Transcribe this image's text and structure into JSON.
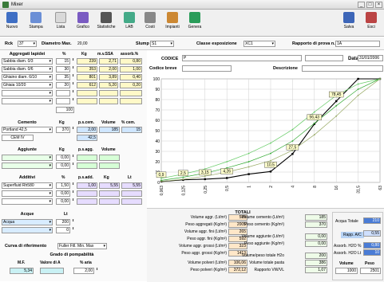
{
  "window": {
    "title": "Mixer"
  },
  "toolbar": {
    "nuovo": "Nuovo",
    "stampa": "Stampa",
    "lista": "Lista",
    "grafico": "Grafico",
    "statistiche": "Statistiche",
    "lab": "LAB",
    "costi": "Costi",
    "impianti": "Impianti",
    "genera": "Genera",
    "salva": "Salva",
    "esci": "Esci"
  },
  "header": {
    "rck_label": "Rck",
    "rck_value": "37",
    "diametro_label": "Diametro Max.",
    "diametro_value": "20,00",
    "slump_label": "Slump",
    "slump_value": "S1",
    "classe_label": "Classe esposizione",
    "classe_value": "XC1",
    "rapporto_label": "Rapporto di prova n.",
    "rapporto_value": "1A"
  },
  "aggregati": {
    "title": "Aggregati lapidei",
    "col_pct": "%",
    "col_kg": "Kg",
    "col_mv": "m.v.SSA",
    "col_ass": "assorb.%",
    "rows": [
      {
        "name": "Sabbia diam. 0/3",
        "pct": "15",
        "kg": "239",
        "mv": "2,71",
        "ass": "0,80"
      },
      {
        "name": "Sabbia diam. 0/6",
        "pct": "30",
        "kg": "353",
        "mv": "2,00",
        "ass": "1,00"
      },
      {
        "name": "Ghiaino diam. 6/10",
        "pct": "35",
        "kg": "801",
        "mv": "3,89",
        "ass": "0,40"
      },
      {
        "name": "Ghiaia 10/20",
        "pct": "20",
        "kg": "612",
        "mv": "5,20",
        "ass": "0,20"
      },
      {
        "name": "",
        "pct": "",
        "kg": "",
        "mv": "",
        "ass": ""
      },
      {
        "name": "",
        "pct": "",
        "kg": "",
        "mv": "",
        "ass": ""
      }
    ],
    "total": "100"
  },
  "cemento": {
    "title": "Cemento",
    "col_kg": "Kg",
    "col_ps": "p.s.cem.",
    "col_vol": "Volume",
    "col_pct": "% cem.",
    "rows": [
      {
        "name": "Portland 42,5",
        "kg": "370",
        "ps": "2,00",
        "vol": "185",
        "pct": "15"
      },
      {
        "name": "CEM IV",
        "kg": "",
        "ps": "42,5",
        "vol": "",
        "pct": ""
      }
    ]
  },
  "aggiunte": {
    "title": "Aggiunte",
    "col_kg": "Kg",
    "col_ps": "p.s.agg.",
    "col_vol": "Volume",
    "rows": [
      {
        "kg": "0,00"
      },
      {
        "kg": "0,00"
      }
    ]
  },
  "additivi": {
    "title": "Additivi",
    "col_pct": "%",
    "col_ps": "p.s.add.",
    "col_kg": "Kg",
    "col_lt": "Lt",
    "rows": [
      {
        "name": "Superfluid Rh580",
        "pct": "1,50",
        "ps": "1,00",
        "kg": "5,55",
        "lt": "5,55"
      },
      {
        "name": "",
        "pct": "0,00",
        "ps": "",
        "kg": "",
        "lt": ""
      },
      {
        "name": "",
        "pct": "0,00",
        "ps": "",
        "kg": "",
        "lt": ""
      }
    ]
  },
  "acque": {
    "title": "Acque",
    "col_lt": "Lt",
    "rows": [
      {
        "name": "Acqua",
        "lt": "200"
      },
      {
        "name": "",
        "lt": "0"
      }
    ]
  },
  "curva": {
    "label": "Curva di riferimento",
    "value": "Fuller Fill. Min. Max"
  },
  "pompabilita": {
    "title": "Grado di pompabilità",
    "mf_label": "M.F.",
    "valore_label": "Valore di A",
    "aria_label": "% aria",
    "mf": "5,34",
    "valore": "",
    "aria": "2,00"
  },
  "codice": {
    "label": "CODICE",
    "value": "P",
    "breve_label": "Codice breve",
    "breve_value": "",
    "descrizione_label": "Descrizione",
    "data_label": "Data",
    "data_value": "31/01/2006"
  },
  "chart_data": {
    "type": "line",
    "x": [
      "0,063",
      "0,125",
      "0,25",
      "0,5",
      "1",
      "2",
      "4",
      "8",
      "16",
      "31,5",
      "63"
    ],
    "ylim": [
      0,
      100
    ],
    "yticks": [
      "0",
      "10",
      "20",
      "30",
      "40",
      "50",
      "60",
      "70",
      "80",
      "90",
      "100"
    ],
    "series": [
      {
        "color": "#000000",
        "values": [
          0.9,
          2.5,
          3.15,
          4.26,
          8,
          10.5,
          27.5,
          56.43,
          78.45,
          100,
          100
        ]
      },
      {
        "color": "#33aa33",
        "values": [
          2,
          5,
          9,
          14,
          20,
          28,
          40,
          57,
          74,
          90,
          100
        ]
      },
      {
        "color": "#66cc66",
        "values": [
          4,
          8,
          13,
          20,
          28,
          38,
          51,
          68,
          84,
          95,
          100
        ]
      },
      {
        "color": "#99aa66",
        "values": [
          1,
          3,
          6,
          10,
          15,
          21,
          31,
          46,
          64,
          84,
          100
        ]
      }
    ],
    "labels": [
      {
        "x": "0,063",
        "y": 0.9,
        "text": "0,9"
      },
      {
        "x": "0,125",
        "y": 2.5,
        "text": "2,5"
      },
      {
        "x": "0,25",
        "y": 3.15,
        "text": "3,15"
      },
      {
        "x": "0,5",
        "y": 4.26,
        "text": "4,26"
      },
      {
        "x": "2",
        "y": 10.5,
        "text": "10,5"
      },
      {
        "x": "4",
        "y": 27.5,
        "text": "27,5"
      },
      {
        "x": "8",
        "y": 56.43,
        "text": "56,43"
      },
      {
        "x": "16",
        "y": 78.45,
        "text": "78,45"
      },
      {
        "x": "31,5",
        "y": 100,
        "text": "100"
      }
    ],
    "grid": true
  },
  "totali": {
    "title": "TOTALI",
    "col1": [
      {
        "label": "Volume aggr. (Lt/m³)",
        "value": "589"
      },
      {
        "label": "Peso aggregati (Kg/m³)",
        "value": "2005"
      },
      {
        "label": "Volume aggr. fini (Lt/m³)",
        "value": "265"
      },
      {
        "label": "Peso aggr. fini (Kg/m³)",
        "value": "592"
      },
      {
        "label": "Volume aggr. grossi (Lt/m³)",
        "value": "323"
      },
      {
        "label": "Peso aggr. grossi (Kg/m³)",
        "value": "1413"
      },
      {
        "label": "Volume polveri (Lt/m³)",
        "value": "106,06"
      },
      {
        "label": "Peso polveri (Kg/m³)",
        "value": "372,12"
      }
    ],
    "col2": [
      {
        "label": "Volume cemento (Lt/m³)",
        "value": "185"
      },
      {
        "label": "Peso cemento (Kg/m³)",
        "value": "370"
      },
      {
        "label": "Volume aggiunte (Lt/m³)",
        "value": "0,00"
      },
      {
        "label": "Peso aggiunte (Kg/m³)",
        "value": "0,00"
      },
      {
        "label": "Volume/peso totale H2o",
        "value": "200"
      },
      {
        "label": "Volume totale pasta",
        "value": "386"
      },
      {
        "label": "Rapporto VW/VL",
        "value": "1,07"
      }
    ],
    "acqua_totale_label": "Acqua Totale",
    "acqua_totale": "210",
    "rapp_ac_label": "Rapp. A/C",
    "rapp_ac": "0,55",
    "assorb1_label": "Assorb. H2O %",
    "assorb1": "0,80",
    "assorb2_label": "Assorb. H2O Lt",
    "assorb2": "10",
    "volume_label": "Volume",
    "peso_label": "Peso",
    "volume": "1000",
    "peso": "2501"
  }
}
